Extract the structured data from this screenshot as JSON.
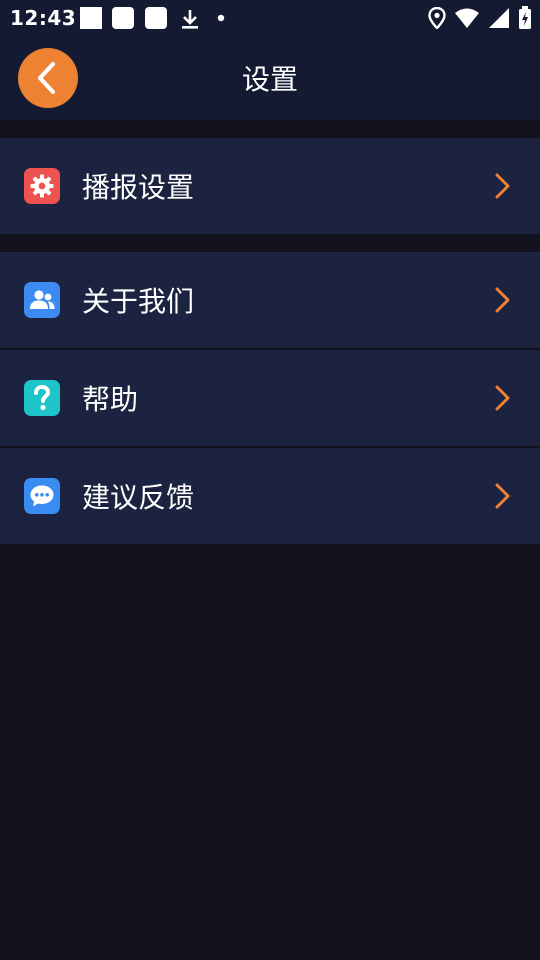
{
  "status_bar": {
    "time": "12:43"
  },
  "header": {
    "title": "设置",
    "back_icon": "chevron-left-icon"
  },
  "colors": {
    "accent": "#ee8233",
    "header_bg": "#151a33",
    "row_bg": "#1c2340",
    "page_bg": "#12121e",
    "icon_broadcast": "#ef5350",
    "icon_about": "#3d8bf2",
    "icon_help": "#1fc4c9",
    "icon_feedback": "#3a8df0"
  },
  "menu_groups": [
    {
      "items": [
        {
          "label": "播报设置",
          "icon": "gear-icon"
        }
      ]
    },
    {
      "items": [
        {
          "label": "关于我们",
          "icon": "users-icon"
        },
        {
          "label": "帮助",
          "icon": "question-icon"
        },
        {
          "label": "建议反馈",
          "icon": "chat-bubble-icon"
        }
      ]
    }
  ]
}
